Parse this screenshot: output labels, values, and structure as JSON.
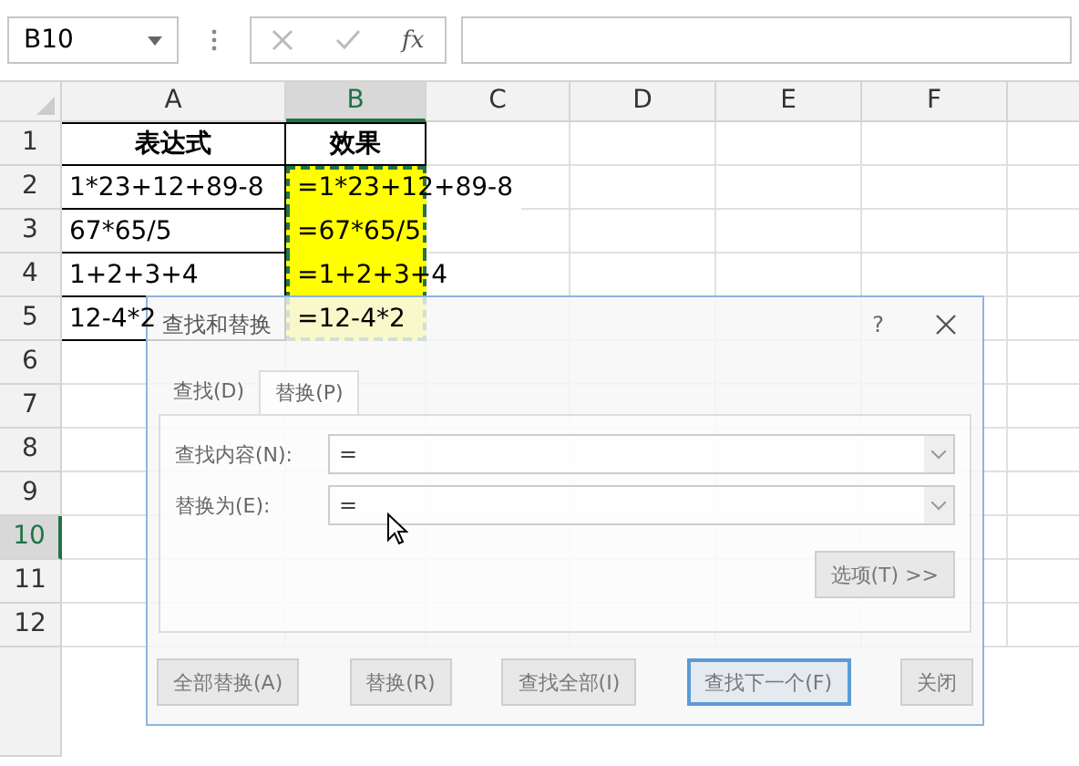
{
  "formula_bar": {
    "name_box": "B10",
    "fx": "fx"
  },
  "columns": [
    {
      "label": "A",
      "selected": false
    },
    {
      "label": "B",
      "selected": true
    },
    {
      "label": "C",
      "selected": false
    },
    {
      "label": "D",
      "selected": false
    },
    {
      "label": "E",
      "selected": false
    },
    {
      "label": "F",
      "selected": false
    }
  ],
  "rows": [
    {
      "label": "1",
      "selected": false,
      "cells": [
        {
          "kind": "header",
          "text": "表达式"
        },
        {
          "kind": "header",
          "text": "效果"
        }
      ]
    },
    {
      "label": "2",
      "selected": false,
      "cells": [
        {
          "kind": "plain",
          "text": "1*23+12+89-8"
        },
        {
          "kind": "highlight",
          "text": "=1*23+12+89-8"
        }
      ]
    },
    {
      "label": "3",
      "selected": false,
      "cells": [
        {
          "kind": "plain",
          "text": "67*65/5"
        },
        {
          "kind": "highlight",
          "text": "=67*65/5"
        }
      ]
    },
    {
      "label": "4",
      "selected": false,
      "cells": [
        {
          "kind": "plain",
          "text": "1+2+3+4"
        },
        {
          "kind": "highlight",
          "text": "=1+2+3+4"
        }
      ]
    },
    {
      "label": "5",
      "selected": false,
      "cells": [
        {
          "kind": "plain",
          "text": "12-4*2"
        },
        {
          "kind": "highlight",
          "text": "=12-4*2"
        }
      ]
    },
    {
      "label": "6",
      "selected": false,
      "cells": []
    },
    {
      "label": "7",
      "selected": false,
      "cells": []
    },
    {
      "label": "8",
      "selected": false,
      "cells": []
    },
    {
      "label": "9",
      "selected": false,
      "cells": []
    },
    {
      "label": "10",
      "selected": true,
      "cells": []
    },
    {
      "label": "11",
      "selected": false,
      "cells": []
    },
    {
      "label": "12",
      "selected": false,
      "cells": []
    }
  ],
  "dialog": {
    "title": "查找和替换",
    "help": "?",
    "tabs": [
      {
        "label": "查找(D)",
        "selected": false
      },
      {
        "label": "替换(P)",
        "selected": true
      }
    ],
    "fields": [
      {
        "label": "查找内容(N):",
        "value": "="
      },
      {
        "label": "替换为(E):",
        "value": "="
      }
    ],
    "options_button": "选项(T) >>",
    "buttons": [
      {
        "label": "全部替换(A)",
        "focused": false
      },
      {
        "label": "替换(R)",
        "focused": false
      },
      {
        "label": "查找全部(I)",
        "focused": false
      },
      {
        "label": "查找下一个(F)",
        "focused": true
      },
      {
        "label": "关闭",
        "focused": false
      }
    ]
  }
}
